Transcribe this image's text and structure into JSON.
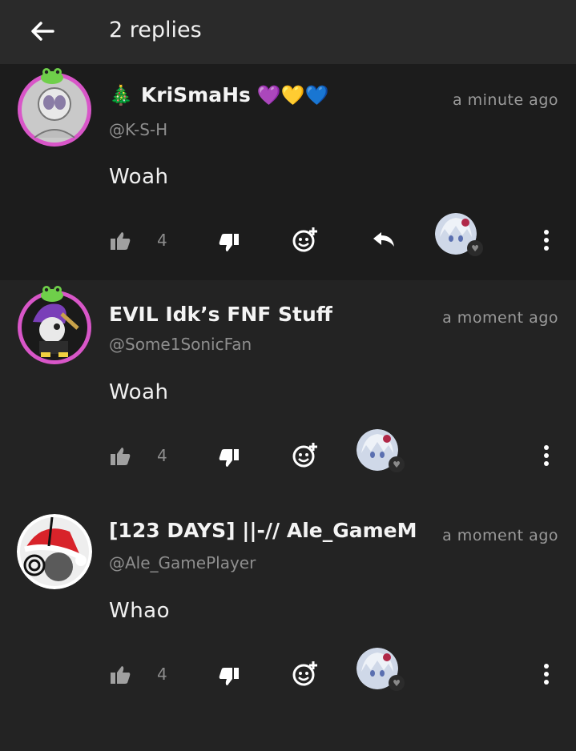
{
  "header": {
    "title": "2 replies"
  },
  "comments": [
    {
      "tree_emoji": "🎄",
      "name": "KriSmaHs",
      "hearts": "💜💛💙",
      "handle": "@K-S-H",
      "time": "a minute ago",
      "text": "Woah",
      "likes": "4"
    },
    {
      "name": "EVIL Idk’s FNF Stuff",
      "handle": "@Some1SonicFan",
      "time": "a moment ago",
      "text": "Woah",
      "likes": "4"
    },
    {
      "name": "[123 DAYS] ||-// Ale_GameM",
      "handle": "@Ale_GamePlayer",
      "time": "a moment ago",
      "text": "Whao",
      "likes": "4"
    }
  ],
  "colors": {
    "ring_pink": "#d856c8",
    "bg": "#232323",
    "highlight_bg": "#1c1c1c"
  }
}
